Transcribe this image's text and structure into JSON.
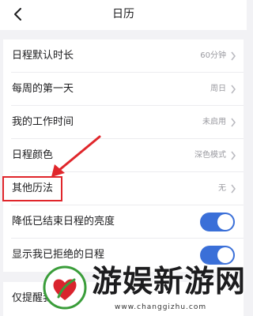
{
  "header": {
    "title": "日历"
  },
  "settings": [
    {
      "label": "日程默认时长",
      "value": "60分钟",
      "type": "link"
    },
    {
      "label": "每周的第一天",
      "value": "周日",
      "type": "link"
    },
    {
      "label": "我的工作时间",
      "value": "未启用",
      "type": "link"
    },
    {
      "label": "日程颜色",
      "value": "深色模式",
      "type": "link"
    },
    {
      "label": "其他历法",
      "value": "无",
      "type": "link",
      "highlighted": true
    },
    {
      "label": "降低已结束日程的亮度",
      "type": "toggle",
      "on": true
    },
    {
      "label": "显示我已拒绝的日程",
      "type": "toggle",
      "on": true
    }
  ],
  "bottom_row": {
    "label": "仅提醒我"
  },
  "watermark": {
    "brand": "游娱新游网",
    "url": "www.changgizhu.com"
  },
  "colors": {
    "accent": "#3a6fd8",
    "annotation": "#e0262b",
    "background": "#f2f2f5"
  }
}
